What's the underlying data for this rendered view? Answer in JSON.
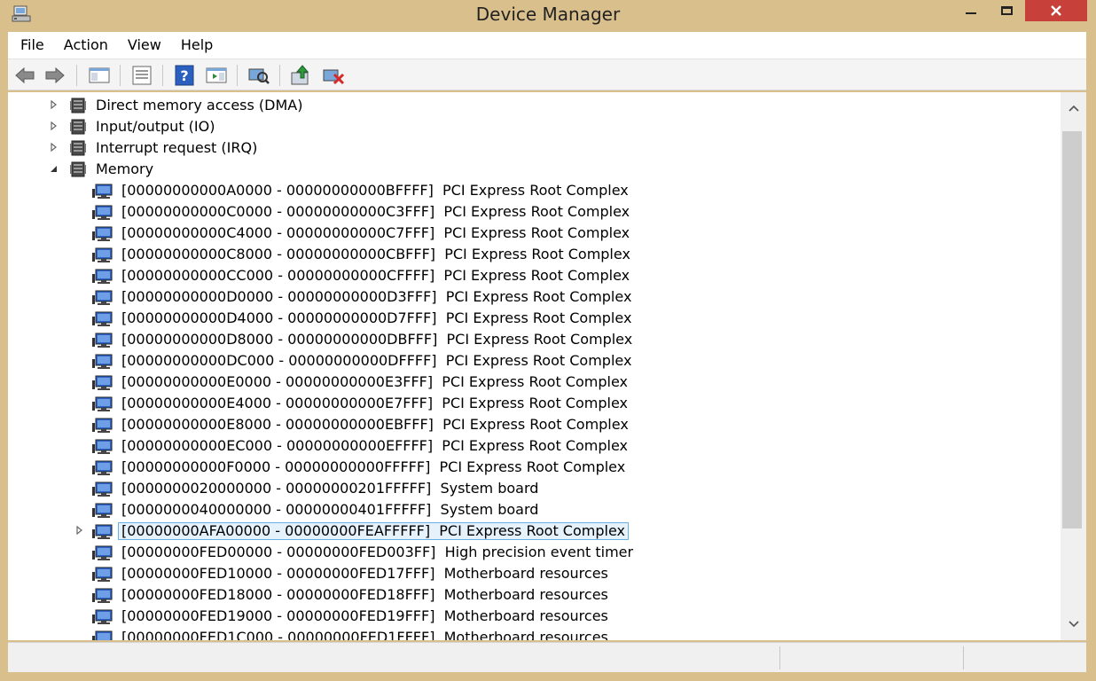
{
  "window": {
    "title": "Device Manager"
  },
  "menu": [
    "File",
    "Action",
    "View",
    "Help"
  ],
  "toolbar_icons": [
    "back-arrow-icon",
    "forward-arrow-icon",
    "console-tree-icon",
    "properties-icon",
    "help-icon",
    "action-pane-icon",
    "scan-hardware-icon",
    "update-driver-icon",
    "uninstall-device-icon"
  ],
  "tree": {
    "categories": [
      {
        "label": "Direct memory access (DMA)",
        "expanded": false
      },
      {
        "label": "Input/output (IO)",
        "expanded": false
      },
      {
        "label": "Interrupt request (IRQ)",
        "expanded": false
      },
      {
        "label": "Memory",
        "expanded": true
      }
    ],
    "memory_items": [
      {
        "range": "[00000000000A0000 - 00000000000BFFFF]",
        "device": "PCI Express Root Complex"
      },
      {
        "range": "[00000000000C0000 - 00000000000C3FFF]",
        "device": "PCI Express Root Complex"
      },
      {
        "range": "[00000000000C4000 - 00000000000C7FFF]",
        "device": "PCI Express Root Complex"
      },
      {
        "range": "[00000000000C8000 - 00000000000CBFFF]",
        "device": "PCI Express Root Complex"
      },
      {
        "range": "[00000000000CC000 - 00000000000CFFFF]",
        "device": "PCI Express Root Complex"
      },
      {
        "range": "[00000000000D0000 - 00000000000D3FFF]",
        "device": "PCI Express Root Complex"
      },
      {
        "range": "[00000000000D4000 - 00000000000D7FFF]",
        "device": "PCI Express Root Complex"
      },
      {
        "range": "[00000000000D8000 - 00000000000DBFFF]",
        "device": "PCI Express Root Complex"
      },
      {
        "range": "[00000000000DC000 - 00000000000DFFFF]",
        "device": "PCI Express Root Complex"
      },
      {
        "range": "[00000000000E0000 - 00000000000E3FFF]",
        "device": "PCI Express Root Complex"
      },
      {
        "range": "[00000000000E4000 - 00000000000E7FFF]",
        "device": "PCI Express Root Complex"
      },
      {
        "range": "[00000000000E8000 - 00000000000EBFFF]",
        "device": "PCI Express Root Complex"
      },
      {
        "range": "[00000000000EC000 - 00000000000EFFFF]",
        "device": "PCI Express Root Complex"
      },
      {
        "range": "[00000000000F0000 - 00000000000FFFFF]",
        "device": "PCI Express Root Complex"
      },
      {
        "range": "[0000000020000000 - 00000000201FFFFF]",
        "device": "System board"
      },
      {
        "range": "[0000000040000000 - 00000000401FFFFF]",
        "device": "System board"
      },
      {
        "range": "[00000000AFA00000 - 00000000FEAFFFFF]",
        "device": "PCI Express Root Complex",
        "selected": true,
        "has_children": true
      },
      {
        "range": "[00000000FED00000 - 00000000FED003FF]",
        "device": "High precision event timer"
      },
      {
        "range": "[00000000FED10000 - 00000000FED17FFF]",
        "device": "Motherboard resources"
      },
      {
        "range": "[00000000FED18000 - 00000000FED18FFF]",
        "device": "Motherboard resources"
      },
      {
        "range": "[00000000FED19000 - 00000000FED19FFF]",
        "device": "Motherboard resources"
      },
      {
        "range": "[00000000FED1C000 - 00000000FED1FFFF]",
        "device": "Motherboard resources"
      }
    ]
  },
  "colors": {
    "frame": "#d9bf8c",
    "close": "#c7403a",
    "selection_border": "#6bb0e3",
    "selection_fill": "#e5f1fb"
  }
}
